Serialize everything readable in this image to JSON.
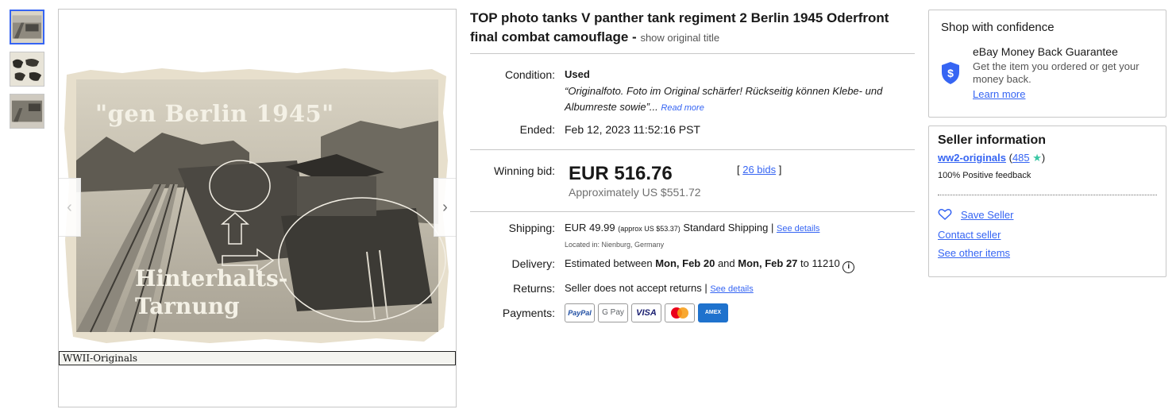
{
  "gallery": {
    "thumbnails": [
      "thumbnail-1",
      "thumbnail-2",
      "thumbnail-3"
    ],
    "photo": {
      "caption": "\"gen Berlin 1945\"",
      "label": "WWII-Originals",
      "line1": "Hinterhalts-",
      "line2": "Tarnung"
    },
    "prev_icon": "chevron-left-icon",
    "next_icon": "chevron-right-icon"
  },
  "listing": {
    "title": "TOP photo tanks V panther tank regiment 2 Berlin 1945 Oderfront final combat camouflage -",
    "show_original": "show original title",
    "condition_label": "Condition:",
    "condition_value": "Used",
    "condition_note": "“Originalfoto. Foto im Original schärfer! Rückseitig können Klebe- und Albumreste sowie”...",
    "read_more": "Read more",
    "ended_label": "Ended:",
    "ended_value": "Feb 12, 2023 11:52:16 PST",
    "winning_bid_label": "Winning bid:",
    "winning_bid": "EUR 516.76",
    "approx": "Approximately US $551.72",
    "bids": "26 bids",
    "shipping_label": "Shipping:",
    "shipping_price": "EUR 49.99",
    "shipping_approx": "(approx US $53.37)",
    "shipping_service": "Standard Shipping |",
    "see_details": "See details",
    "located": "Located in: Nienburg, Germany",
    "delivery_label": "Delivery:",
    "delivery_prefix": "Estimated between",
    "delivery_from": "Mon, Feb 20",
    "delivery_and": "and",
    "delivery_to": "Mon, Feb 27",
    "delivery_zip": "to 11210",
    "returns_label": "Returns:",
    "returns_value": "Seller does not accept returns |",
    "returns_details": "See details",
    "payments_label": "Payments:",
    "payment_methods": [
      "PayPal",
      "G Pay",
      "VISA",
      "Mastercard",
      "AMEX"
    ]
  },
  "confidence": {
    "heading": "Shop with confidence",
    "guarantee_title": "eBay Money Back Guarantee",
    "guarantee_text": "Get the item you ordered or get your money back.",
    "learn_more": "Learn more",
    "icon": "shield-dollar-icon"
  },
  "seller": {
    "heading": "Seller information",
    "name": "ww2-originals",
    "feedback_open": "(",
    "feedback_score": "485",
    "feedback_close": ")",
    "star_icon": "star-icon",
    "positive": "100% Positive feedback",
    "save_seller": "Save Seller",
    "contact": "Contact seller",
    "other_items": "See other items"
  },
  "colors": {
    "link": "#3665f3",
    "star": "#3ac7a4",
    "text": "#191919"
  }
}
